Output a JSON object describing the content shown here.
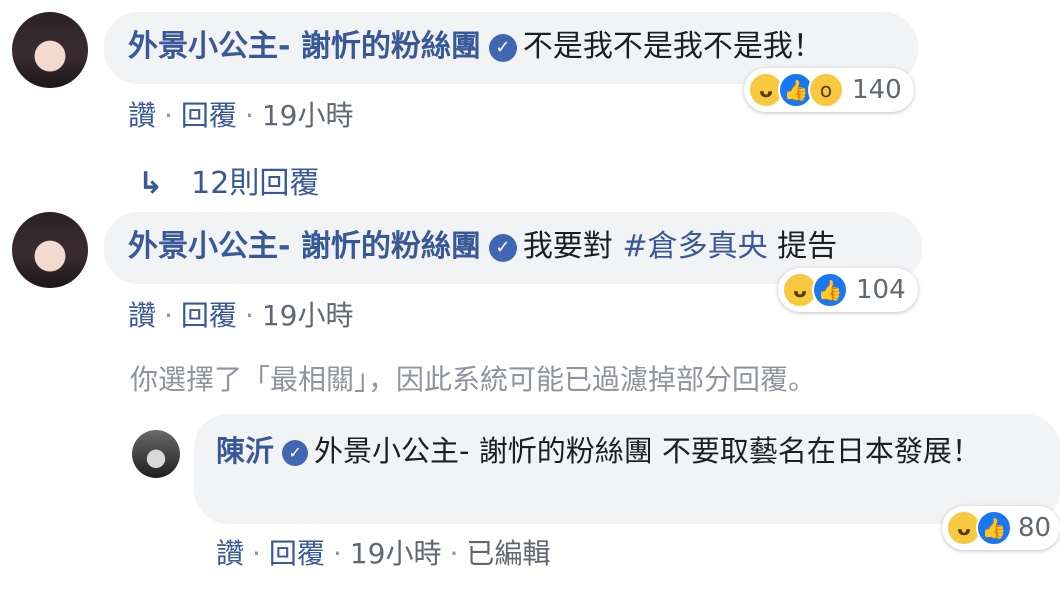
{
  "comments": [
    {
      "author": "外景小公主- 謝忻的粉絲團",
      "text": "不是我不是我不是我！",
      "reaction_count": "140",
      "actions": {
        "like": "讚",
        "reply": "回覆",
        "time": "19小時"
      }
    },
    {
      "author": "外景小公主- 謝忻的粉絲團",
      "text_prefix": "我要對 ",
      "hashtag": "#倉多真央",
      "text_suffix": " 提告",
      "reaction_count": "104",
      "actions": {
        "like": "讚",
        "reply": "回覆",
        "time": "19小時"
      }
    }
  ],
  "replies_link": "12則回覆",
  "filter_note": "你選擇了「最相關」，因此系統可能已過濾掉部分回覆。",
  "reply": {
    "author": "陳沂",
    "mention": "外景小公主- 謝忻的粉絲團",
    "text": " 不要取藝名在日本發展！",
    "reaction_count": "80",
    "actions": {
      "like": "讚",
      "reply": "回覆",
      "time": "19小時",
      "edited": "已編輯"
    }
  },
  "icons": {
    "verified": "verified-check-icon",
    "reply_arrow": "reply-arrow-icon",
    "haha": "haha-reaction-icon",
    "like": "like-reaction-icon",
    "wow": "wow-reaction-icon"
  },
  "colors": {
    "link": "#385898",
    "bubble": "#f2f3f5",
    "muted": "#90949c",
    "like_blue": "#1877f2"
  }
}
